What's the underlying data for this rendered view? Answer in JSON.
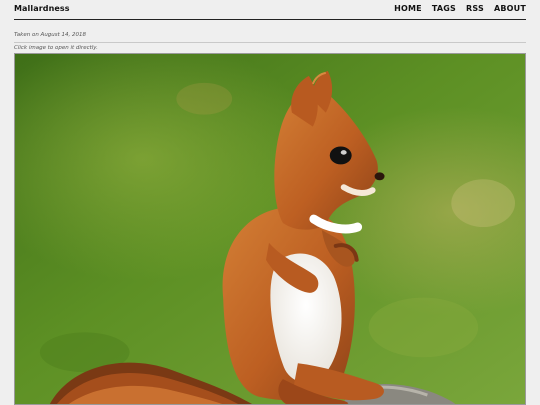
{
  "site": {
    "title": "Mallardness"
  },
  "nav": {
    "items": [
      {
        "label": "HOME"
      },
      {
        "label": "TAGS"
      },
      {
        "label": "RSS"
      },
      {
        "label": "ABOUT"
      }
    ]
  },
  "post": {
    "taken": "Taken on August 14, 2018",
    "hint": "Click image to open it directly."
  },
  "colors": {
    "background": "#efefef",
    "text": "#111111",
    "muted": "#555555",
    "photo_green": "#5b8f2a",
    "squirrel_orange": "#c96a2a"
  }
}
